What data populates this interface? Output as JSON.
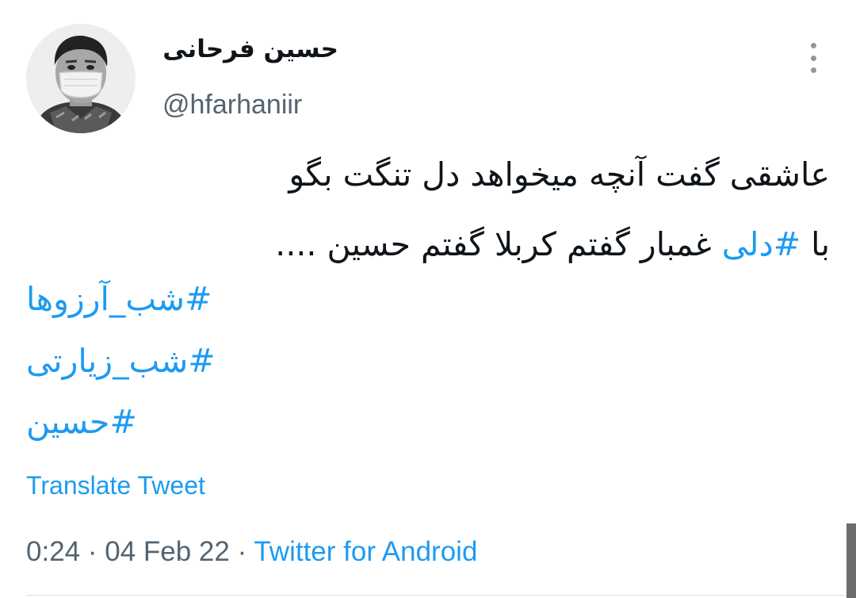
{
  "author": {
    "display_name": "حسین فرحانی",
    "handle": "@hfarhaniir",
    "avatar_icon": "profile-photo-masked-person"
  },
  "more_icon": "more-vertical-icon",
  "tweet": {
    "line1": "عاشقی گفت آنچه میخواهد دل تنگت بگو",
    "line2_before": "با ",
    "line2_link": "#دلی",
    "line2_after": " غمبار گفتم کربلا گفتم حسین ....",
    "hashtags": [
      "#شب_آرزوها",
      "#شب_زیارتی",
      "#حسین"
    ]
  },
  "translate_label": "Translate Tweet",
  "meta": {
    "time": "0:24",
    "separator": " · ",
    "date": "04 Feb 22",
    "source": "Twitter for Android"
  },
  "colors": {
    "link": "#1d9bf0",
    "text": "#0f1419",
    "muted": "#536471"
  }
}
